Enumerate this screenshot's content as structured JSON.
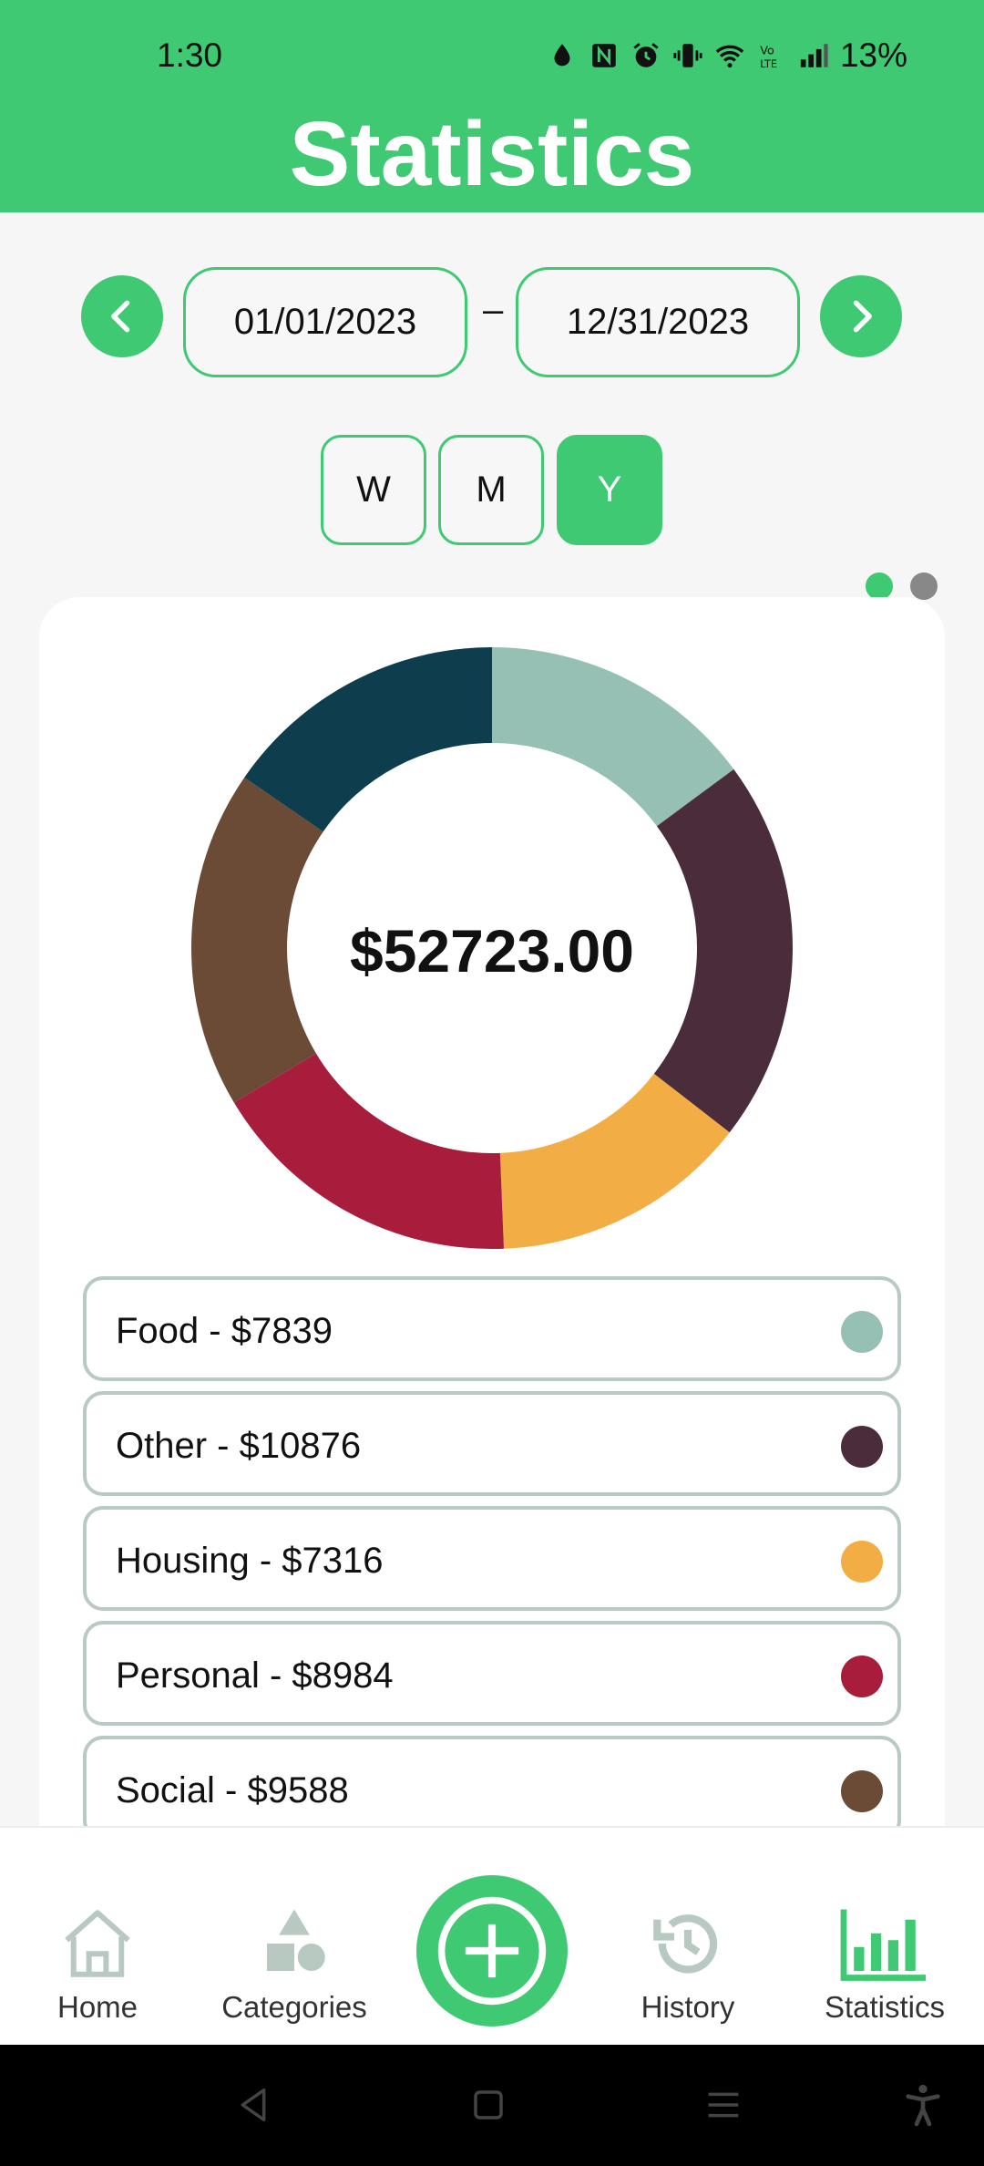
{
  "status_bar": {
    "time": "1:30",
    "battery": "13%"
  },
  "header": {
    "title": "Statistics"
  },
  "date_range": {
    "start": "01/01/2023",
    "separator": "–",
    "end": "12/31/2023"
  },
  "period_toggle": {
    "week": "W",
    "month": "M",
    "year": "Y",
    "selected": "Y"
  },
  "pager": {
    "pages": 2,
    "current": 1,
    "active_color": "#3ec972",
    "inactive_color": "#888888"
  },
  "chart_data": {
    "type": "pie",
    "center_label": "$52723.00",
    "series": [
      {
        "name": "Food",
        "value": 7839,
        "color": "#96c0b4"
      },
      {
        "name": "Other",
        "value": 10876,
        "color": "#4a2c3a"
      },
      {
        "name": "Housing",
        "value": 7316,
        "color": "#f2ad44"
      },
      {
        "name": "Personal",
        "value": 8984,
        "color": "#a81d3c"
      },
      {
        "name": "Social",
        "value": 9588,
        "color": "#6b4a36"
      },
      {
        "name": "",
        "value": 8120,
        "color": "#0e3d4d"
      }
    ]
  },
  "legend": [
    {
      "label": "Food - $7839",
      "color": "#96c0b4"
    },
    {
      "label": "Other - $10876",
      "color": "#4a2c3a"
    },
    {
      "label": "Housing - $7316",
      "color": "#f2ad44"
    },
    {
      "label": "Personal - $8984",
      "color": "#a81d3c"
    },
    {
      "label": "Social - $9588",
      "color": "#6b4a36"
    }
  ],
  "bottom_nav": {
    "home": "Home",
    "categories": "Categories",
    "history": "History",
    "statistics": "Statistics",
    "active": "statistics"
  },
  "colors": {
    "accent": "#3ec972",
    "inactive_icon": "#b8c9c2"
  }
}
